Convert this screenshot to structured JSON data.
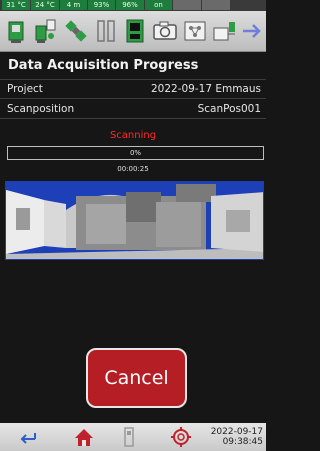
{
  "status_strip": [
    {
      "text": "31 °C",
      "state": "green"
    },
    {
      "text": "24 °C",
      "state": "green"
    },
    {
      "text": "4 m",
      "state": "green"
    },
    {
      "text": "93%",
      "state": "green"
    },
    {
      "text": "96%",
      "state": "green"
    },
    {
      "text": "on",
      "state": "green"
    },
    {
      "text": "",
      "state": "gray"
    },
    {
      "text": "",
      "state": "gray"
    }
  ],
  "toolbar_icons": [
    "scanner-icon",
    "scanner-gps-icon",
    "satellite-icon",
    "tilt-sensor-icon",
    "storage-icon",
    "camera-icon",
    "network-icon",
    "power-icon",
    "forward-arrow-icon"
  ],
  "page": {
    "title": "Data Acquisition Progress"
  },
  "fields": {
    "project_label": "Project",
    "project_value": "2022-09-17 Emmaus",
    "scanpos_label": "Scanposition",
    "scanpos_value": "ScanPos001"
  },
  "progress": {
    "status": "Scanning",
    "percent_text": "0%",
    "fraction": 0,
    "elapsed": "00:00:25"
  },
  "actions": {
    "cancel_label": "Cancel"
  },
  "bottombar": {
    "icons": [
      "back-icon",
      "home-icon",
      "device-icon",
      "settings-gear-icon"
    ],
    "date": "2022-09-17",
    "time": "09:38:45"
  },
  "colors": {
    "status_green": "#1e7d3c",
    "scanning_red": "#ff2a2a",
    "cancel_red": "#b51e24",
    "preview_blue": "#1d3fb8"
  }
}
